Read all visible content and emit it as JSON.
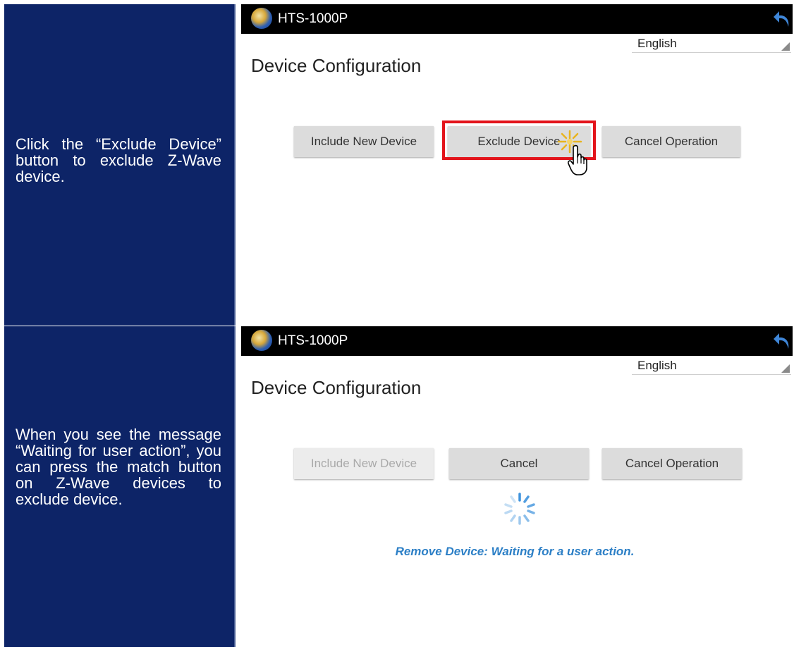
{
  "steps": [
    {
      "instruction": "Click the “Exclude Device” button to exclude Z-Wave device.",
      "app_title": "HTS-1000P",
      "language": "English",
      "page_title": "Device Configuration",
      "buttons": [
        "Include New Device",
        "Exclude Device",
        "Cancel Operation"
      ]
    },
    {
      "instruction": "When you see the message “Waiting for user action”, you can press the match button on Z-Wave devices to exclude device.",
      "app_title": "HTS-1000P",
      "language": "English",
      "page_title": "Device Configuration",
      "buttons": [
        "Include New Device",
        "Cancel",
        "Cancel Operation"
      ],
      "status": "Remove Device: Waiting for a user action."
    }
  ],
  "icons": [
    "app-logo-icon",
    "back-arrow-icon",
    "dropdown-icon",
    "sparkle-icon",
    "pointer-hand-icon",
    "loading-spinner-icon"
  ],
  "colors": {
    "instruction_panel": "#0d2467",
    "title_bar": "#000000",
    "highlight": "#e3141b",
    "status_text": "#2c7fc6",
    "button": "#dcdcdc",
    "button_disabled_text": "#a9a9a9"
  }
}
